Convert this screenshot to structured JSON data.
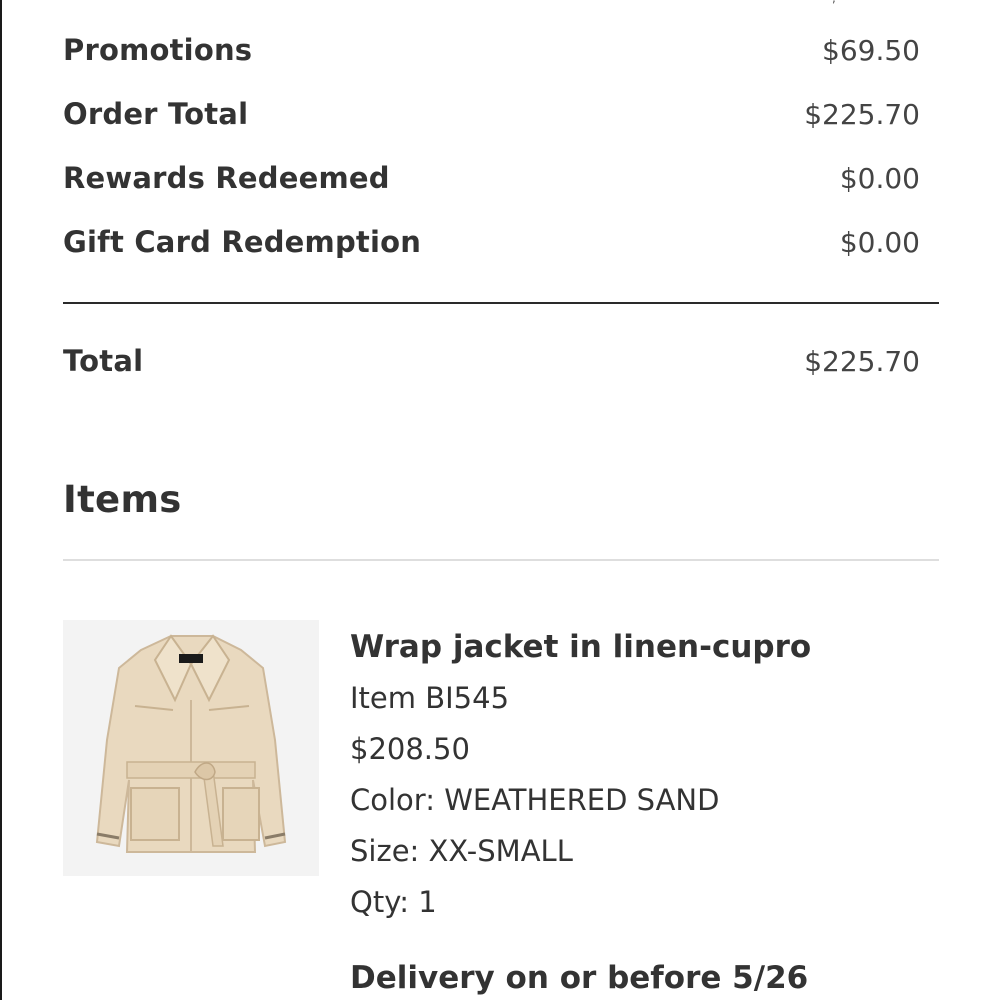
{
  "summary": {
    "rows": [
      {
        "label": "Promotions",
        "value": "$69.50"
      },
      {
        "label": "Order Total",
        "value": "$225.70"
      },
      {
        "label": "Rewards Redeemed",
        "value": "$0.00"
      },
      {
        "label": "Gift Card Redemption",
        "value": "$0.00"
      }
    ],
    "total": {
      "label": "Total",
      "value": "$225.70"
    }
  },
  "items_section": {
    "heading": "Items",
    "items": [
      {
        "name": "Wrap jacket in linen-cupro",
        "item_number": "Item BI545",
        "price": "$208.50",
        "color": "Color: WEATHERED SAND",
        "size": "Size: XX-SMALL",
        "qty": "Qty: 1",
        "image": "wrap-jacket-photo"
      }
    ],
    "delivery": "Delivery on or before 5/26"
  }
}
